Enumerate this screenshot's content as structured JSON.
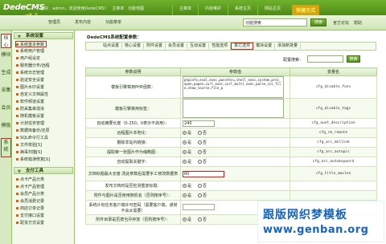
{
  "app": {
    "logo_name": "DedeCMS",
    "logo_version": "v5.7"
  },
  "topbar": {
    "info": [
      "您好：admin，欢迎使用DedeCMS！",
      "主菜单",
      "功能地图"
    ],
    "nav": [
      "主菜单",
      "内容维护",
      "系统主页",
      "网站主页"
    ],
    "favorite": "快捷方式"
  },
  "subbar": {
    "links": [
      "管理员",
      "发布内容",
      "功能菜单"
    ],
    "search_value": "功能搜索",
    "search_button": "搜索",
    "right_links": [
      "官方论坛",
      "帮助"
    ]
  },
  "left_tabs": [
    "核心",
    "模块",
    "生成",
    "采集",
    "会员",
    "模板",
    "系统"
  ],
  "left_menu": {
    "section1_title": "系统设置",
    "section1_items": [
      "系统基本参数",
      "系统用户管理",
      "用户组设定",
      "服务器分布/远程",
      "系统日志管理",
      "验证安全设置",
      "图片水印设置",
      "自定义文档属性",
      "软件频道设置",
      "防采集串混淆",
      "随机模板设置",
      "计划任务管理",
      "数据库备份/还原",
      "SQL命令行工具",
      "文件校验[S]",
      "病毒扫描[S]",
      "系统错误修复[S]"
    ],
    "section2_title": "支付工具",
    "section2_items": [
      "点卡产品分类",
      "点卡产品管理",
      "会员产品分类",
      "会员消费记录",
      "商店订单记录",
      "支付接口设置",
      "配货方式设置"
    ]
  },
  "main": {
    "page_title": "DedeCMS系统配置参数：",
    "tabs": [
      "站点设置",
      "核心设置",
      "附件设置",
      "会员设置",
      "互动设置",
      "性能选项",
      "其它选项",
      "模块设置",
      "添加新变量"
    ],
    "active_tab_index": 6,
    "search_label": "配置搜索：",
    "search_button": "搜索",
    "table_headers": [
      "参数说明",
      "参数值",
      "变量名"
    ],
    "rows": [
      {
        "label": "模板引擎禁用PHP函数：",
        "type": "textarea",
        "value": "phpinfo,eval,exec,passthru,shell_exec,system,proc_open,popen,curl_exec,curl_multi_exec,parse_ini_file,show_source,file_p",
        "var": "cfg_disable_funs"
      },
      {
        "label": "模板引擎禁用标签：",
        "type": "textarea",
        "value": "",
        "var": "cfg_disable_tags"
      },
      {
        "label": "自动摘要长度（0-250，0表示不启用）：",
        "type": "input",
        "value": "240",
        "var": "cfg_auot_description"
      },
      {
        "label": "远程图片本地化：",
        "type": "radio",
        "value": "是",
        "options": [
          "是",
          "否"
        ],
        "var": "cfg_rm_remote"
      },
      {
        "label": "删除非站内链接：",
        "type": "radio",
        "value": "是",
        "options": [
          "是",
          "否"
        ],
        "var": "cfg_arc_dellink"
      },
      {
        "label": "提取第一张图片作为缩略图：",
        "type": "radio",
        "value": "是",
        "options": [
          "是",
          "否"
        ],
        "var": "cfg_arc_autopic"
      },
      {
        "label": "自动提取关键字：",
        "type": "radio",
        "value": "是",
        "options": [
          "是",
          "否"
        ],
        "var": "cfg_arc_autokeyword"
      },
      {
        "label": "文档标题最大长度 改此参数后需要手工修改数据表",
        "type": "input_red",
        "value": "60",
        "var": "cfg_title_maxlen"
      },
      {
        "label": "发布文档时是否检测重复标题：",
        "type": "radio",
        "value": "是",
        "options": [
          "是",
          "否"
        ],
        "var": ""
      },
      {
        "label": "附件与图片是否使用随机名（否则按序号）：",
        "type": "radio",
        "value": "是",
        "options": [
          "是",
          "否"
        ],
        "var": ""
      },
      {
        "label": "系统计划任务客户端许可密码（需要客户端，通常不会太需要）",
        "type": "input",
        "value": "",
        "var": ""
      },
      {
        "label": "附件目录是否按当月存放（否则按序号）：",
        "type": "radio",
        "value": "是",
        "options": [
          "是",
          "否"
        ],
        "var": ""
      }
    ]
  },
  "watermark": {
    "line1": "跟版网织梦模板",
    "line2": "www.genban.org"
  }
}
